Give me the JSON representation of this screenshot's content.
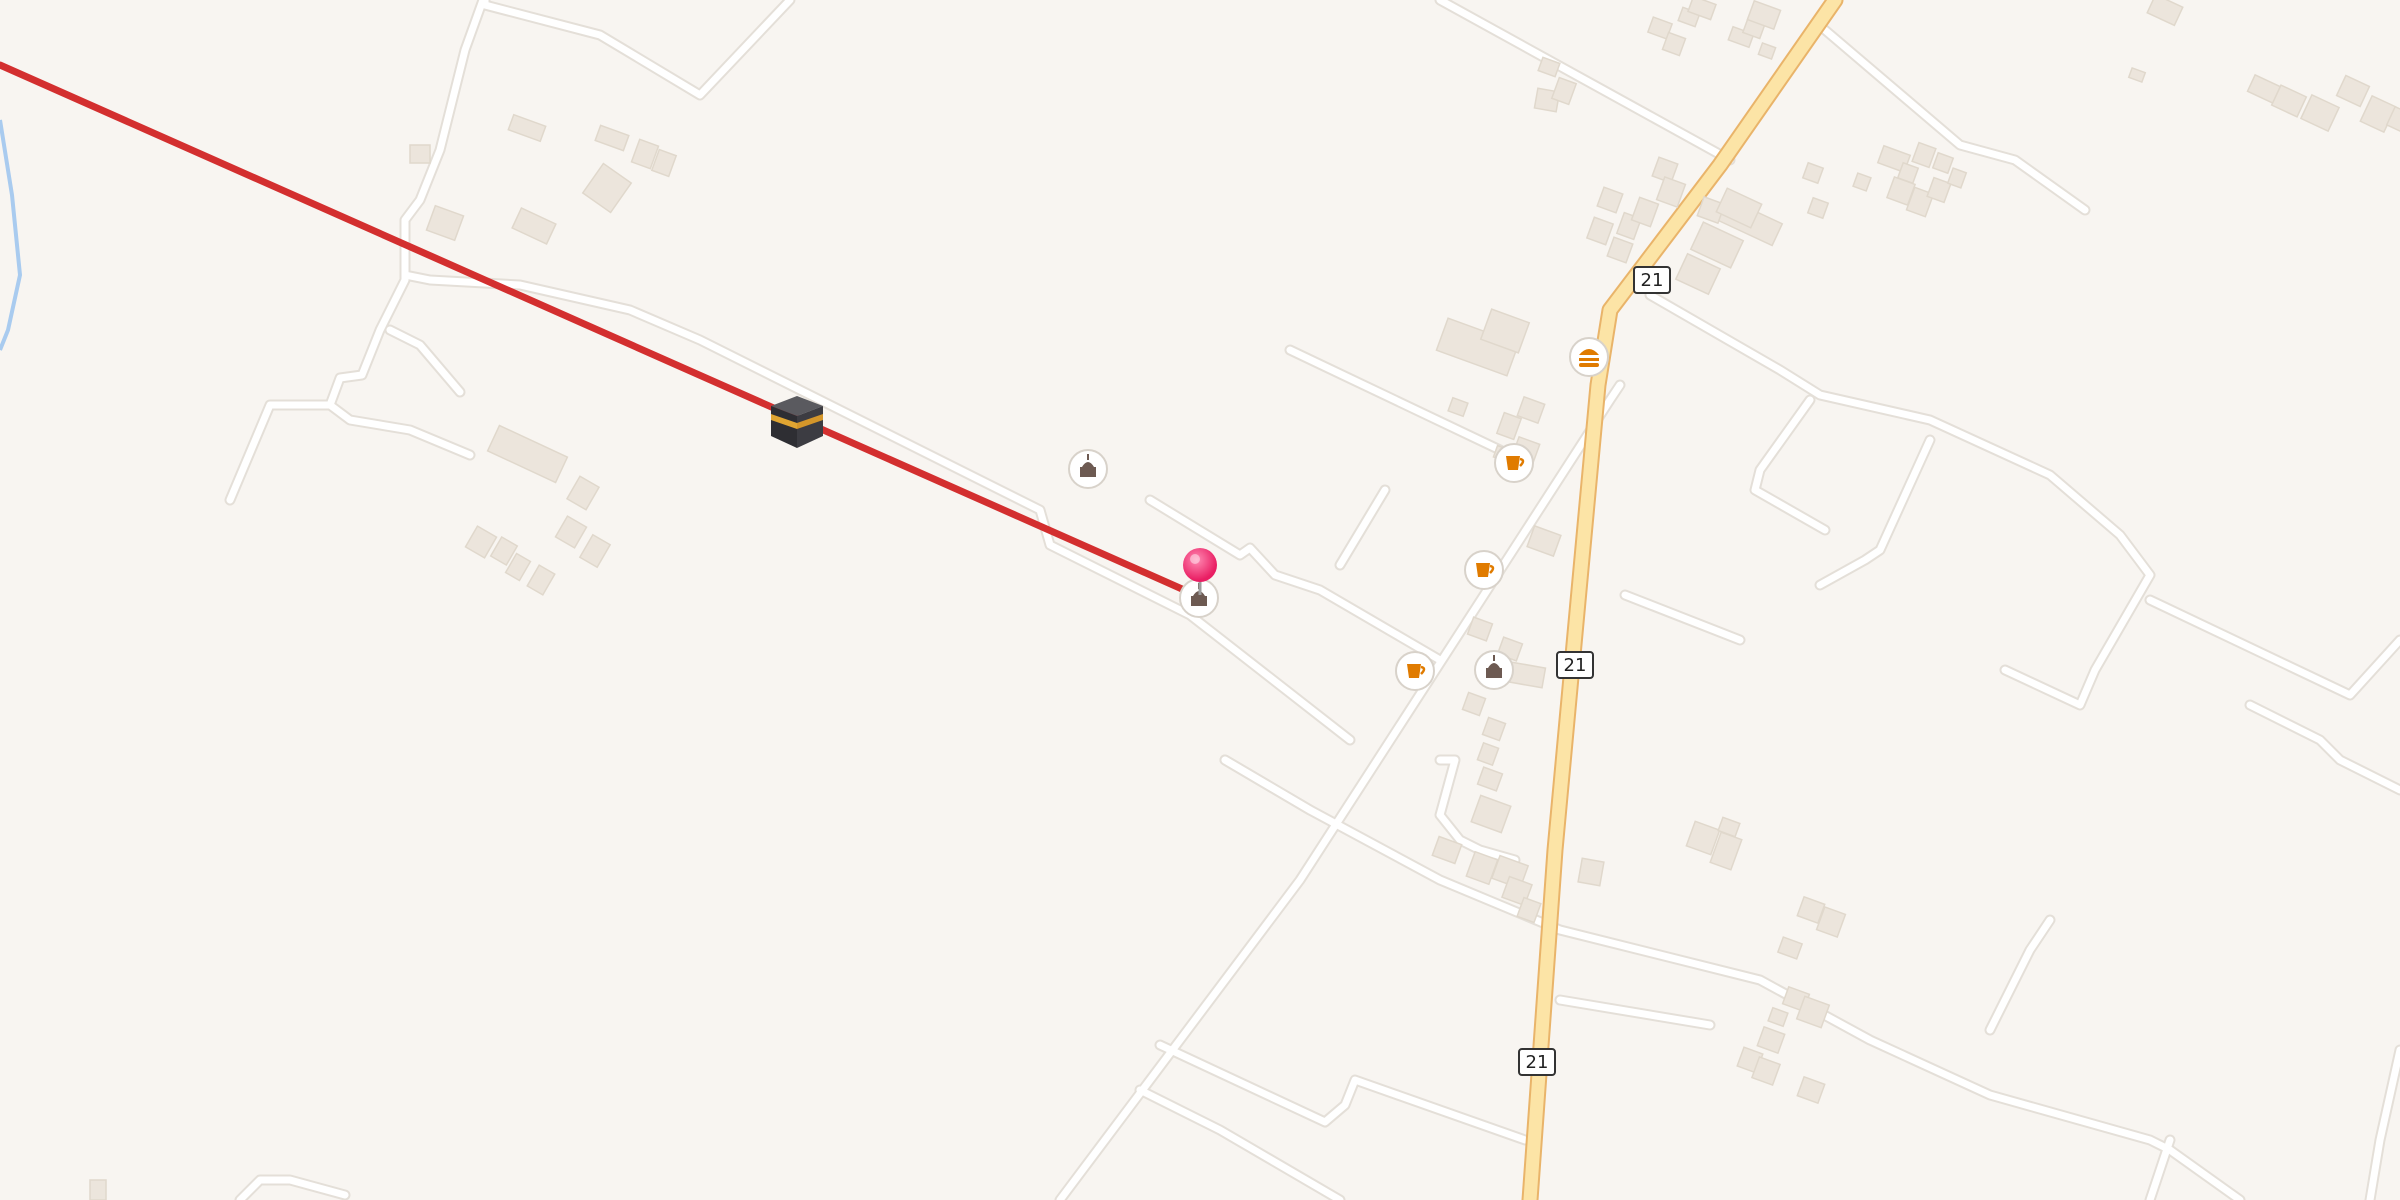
{
  "map": {
    "background_color": "#f8f5f1",
    "colors": {
      "minor_road": "#ffffff",
      "minor_road_casing": "#e4dfd8",
      "primary_road": "#fce4a6",
      "primary_road_casing": "#e9b46a",
      "building": "#ece5dc",
      "building_edge": "#e0d8cc",
      "water": "#a9cbef",
      "qibla_line": "#d32f2f",
      "marker": "#e91e63",
      "poi_bg": "#ffffff",
      "poi_cafe": "#e07b00",
      "poi_mosque": "#6d5a52",
      "poi_food": "#e07b00"
    },
    "route_shields": [
      {
        "label": "21"
      },
      {
        "label": "21"
      },
      {
        "label": "21"
      }
    ],
    "pois": [
      {
        "type": "mosque",
        "icon": "mosque-icon"
      },
      {
        "type": "mosque",
        "icon": "mosque-icon"
      },
      {
        "type": "mosque",
        "icon": "mosque-icon"
      },
      {
        "type": "cafe",
        "icon": "coffee-cup-icon"
      },
      {
        "type": "cafe",
        "icon": "coffee-cup-icon"
      },
      {
        "type": "cafe",
        "icon": "coffee-cup-icon"
      },
      {
        "type": "fast_food",
        "icon": "burger-icon"
      }
    ],
    "qibla": {
      "icon": "kaaba-icon"
    },
    "location_marker": {
      "icon": "map-pin-icon"
    }
  }
}
